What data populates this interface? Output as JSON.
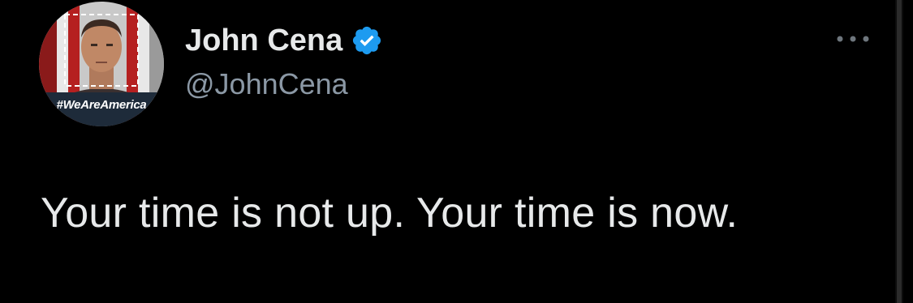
{
  "tweet": {
    "author": {
      "display_name": "John Cena",
      "handle": "@JohnCena",
      "verified": true,
      "avatar": {
        "caption": "#WeAreAmerica",
        "icon": "profile-photo"
      }
    },
    "text": "Your time is not up. Your time is now.",
    "more_icon": "ellipsis-icon"
  },
  "colors": {
    "background": "#000000",
    "primary_text": "#e7e9ea",
    "secondary_text": "#8b98a5",
    "verified_badge": "#1d9bf0"
  }
}
